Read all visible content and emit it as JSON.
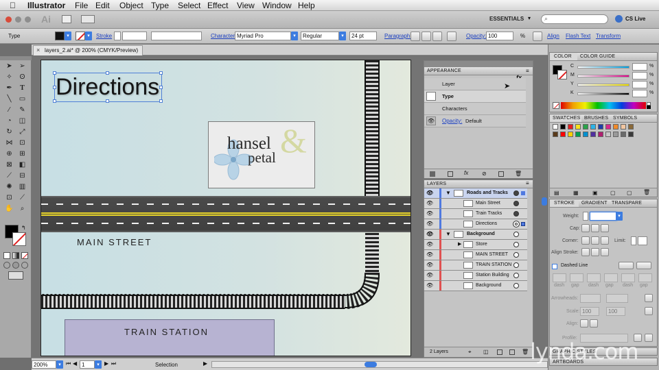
{
  "menubar": {
    "app": "Illustrator",
    "items": [
      "File",
      "Edit",
      "Object",
      "Type",
      "Select",
      "Effect",
      "View",
      "Window",
      "Help"
    ]
  },
  "appbar": {
    "workspace": "ESSENTIALS",
    "cs_live": "CS Live",
    "ai_logo": "Ai"
  },
  "control": {
    "selection_type": "Type",
    "stroke_label": "Stroke",
    "character_label": "Character:",
    "font_family": "Myriad Pro",
    "font_style": "Regular",
    "font_size": "24 pt",
    "paragraph_label": "Paragraph:",
    "opacity_label": "Opacity:",
    "opacity_value": "100",
    "opacity_unit": "%",
    "align_label": "Align",
    "flash_text_label": "Flash Text",
    "transform_label": "Transform"
  },
  "document": {
    "tab_title": "layers_2.ai* @ 200% (CMYK/Preview)"
  },
  "artwork": {
    "heading": "Directions",
    "logo_word1": "hansel",
    "logo_amp": "&",
    "logo_word2": "petal",
    "street_label": "MAIN STREET",
    "station_label": "TRAIN STATION"
  },
  "appearance": {
    "title": "APPEARANCE",
    "fx": "fx",
    "rows": [
      "Layer",
      "Type",
      "Characters"
    ],
    "opacity_label": "Opacity:",
    "opacity_value": "Default"
  },
  "layers": {
    "title": "LAYERS",
    "rows": [
      "Roads and Tracks",
      "Main Street",
      "Train Tracks",
      "Directions",
      "Background",
      "Store",
      "MAIN STREET",
      "TRAIN STATION",
      "Station Building",
      "Background"
    ],
    "footer": "2 Layers",
    "colors": {
      "blue": "#4f79e0",
      "red": "#e05050"
    }
  },
  "color_panel": {
    "tabs": [
      "COLOR",
      "COLOR GUIDE"
    ],
    "channels": [
      "C",
      "M",
      "Y",
      "K"
    ],
    "unit": "%"
  },
  "swatches_panel": {
    "tabs": [
      "SWATCHES",
      "BRUSHES",
      "SYMBOLS"
    ],
    "colors": [
      "#ffffff",
      "#000000",
      "#e62020",
      "#f7e21e",
      "#2aa34a",
      "#2db4e8",
      "#1f3fa8",
      "#d82a8c",
      "#f08a2a",
      "#f2c6a0",
      "#8a6a3a",
      "#5a3a1a",
      "#ff0000",
      "#ffd000",
      "#00a050",
      "#0090d0",
      "#5030a0",
      "#b02070",
      "#c8c8c8",
      "#9a9a9a",
      "#6a6a6a",
      "#3a3a3a"
    ]
  },
  "stroke_panel": {
    "tabs": [
      "STROKE",
      "GRADIENT",
      "TRANSPARE"
    ],
    "weight_label": "Weight:",
    "cap_label": "Cap:",
    "corner_label": "Corner:",
    "limit_label": "Limit:",
    "align_label": "Align Stroke:",
    "dashed_label": "Dashed Line",
    "dash_gap": [
      "dash",
      "gap",
      "dash",
      "gap",
      "dash",
      "gap"
    ],
    "arrowheads_label": "Arrowheads:",
    "scale_label": "Scale:",
    "scale1": "100",
    "scale2": "100",
    "align2_label": "Align:",
    "profile_label": "Profile:",
    "graphic_styles": "GRAPHIC STYLES",
    "artboards": "ARTBOARDS"
  },
  "status": {
    "zoom": "200%",
    "page": "1",
    "tool": "Selection"
  },
  "watermark": "lynda.com"
}
